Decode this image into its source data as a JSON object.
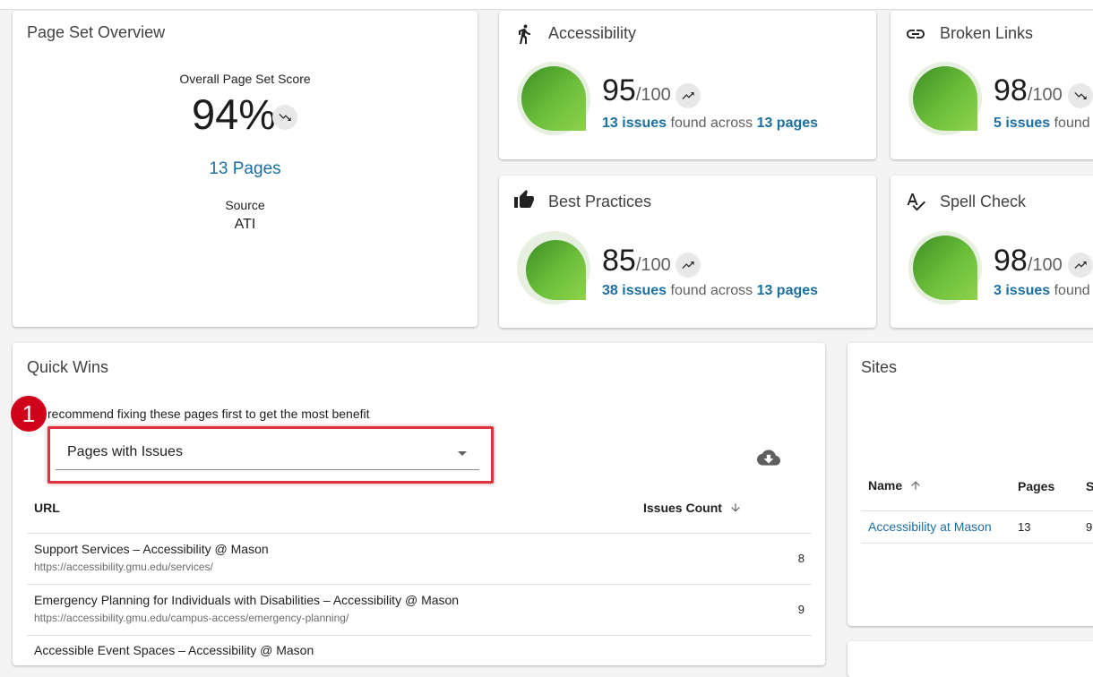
{
  "overview": {
    "title": "Page Set Overview",
    "score_label": "Overall Page Set Score",
    "score": "94%",
    "trend_icon": "trending-down-icon",
    "pages_link": "13 Pages",
    "source_label": "Source",
    "source_value": "ATI"
  },
  "score_cards": [
    {
      "title": "Accessibility",
      "icon": "walking-person-icon",
      "score": "95",
      "den": "/100",
      "trend": "up",
      "score_fraction": 0.95,
      "issues": "13 issues",
      "mid": " found across ",
      "pages": "13 pages"
    },
    {
      "title": "Broken Links",
      "icon": "link-icon",
      "score": "98",
      "den": "/100",
      "trend": "down",
      "score_fraction": 0.98,
      "issues": "5 issues",
      "mid": " found",
      "pages": ""
    },
    {
      "title": "Best Practices",
      "icon": "thumbs-up-icon",
      "score": "85",
      "den": "/100",
      "trend": "up",
      "score_fraction": 0.85,
      "issues": "38 issues",
      "mid": " found across ",
      "pages": "13 pages"
    },
    {
      "title": "Spell Check",
      "icon": "spellcheck-icon",
      "score": "98",
      "den": "/100",
      "trend": "up",
      "score_fraction": 0.98,
      "issues": "3 issues",
      "mid": " found",
      "pages": ""
    }
  ],
  "quick_wins": {
    "title": "Quick Wins",
    "marker": "1",
    "description": "recommend fixing these pages first to get the most benefit",
    "select_value": "Pages with Issues",
    "download_icon": "cloud-download-icon",
    "columns": {
      "url": "URL",
      "issues": "Issues Count"
    },
    "rows": [
      {
        "title": "Support Services – Accessibility @ Mason",
        "url": "https://accessibility.gmu.edu/services/",
        "count": "8"
      },
      {
        "title": "Emergency Planning for Individuals with Disabilities – Accessibility @ Mason",
        "url": "https://accessibility.gmu.edu/campus-access/emergency-planning/",
        "count": "9"
      },
      {
        "title": "Accessible Event Spaces – Accessibility @ Mason",
        "url": "",
        "count": ""
      }
    ]
  },
  "sites": {
    "title": "Sites",
    "columns": {
      "name": "Name",
      "pages": "Pages",
      "third": "S"
    },
    "rows": [
      {
        "name": "Accessibility at Mason",
        "pages": "13",
        "third": "9"
      }
    ]
  },
  "colors": {
    "accent_link": "#1a6fa3",
    "gauge_green": "#6cbf3a",
    "highlight_red": "#e0323c"
  }
}
